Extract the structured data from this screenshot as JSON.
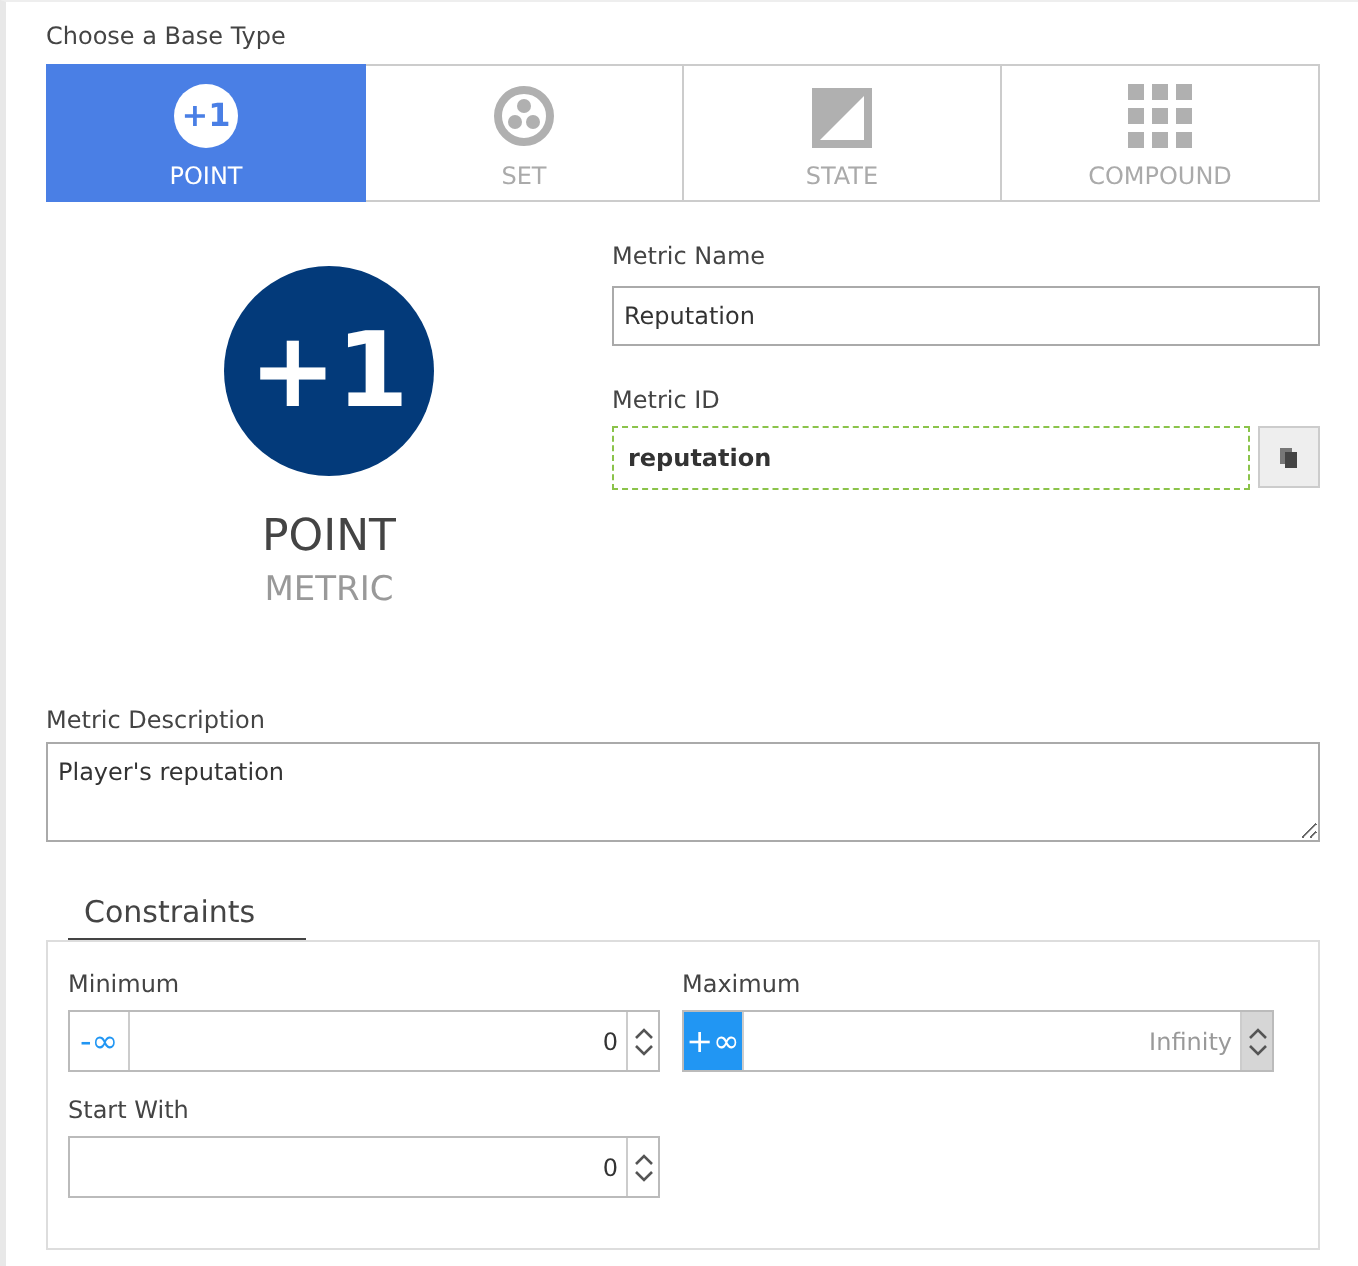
{
  "base_type": {
    "label": "Choose a Base Type",
    "tabs": [
      {
        "kind": "point",
        "label": "POINT",
        "icon_text": "+1",
        "selected": true
      },
      {
        "kind": "set",
        "label": "SET",
        "selected": false
      },
      {
        "kind": "state",
        "label": "STATE",
        "selected": false
      },
      {
        "kind": "compound",
        "label": "COMPOUND",
        "selected": false
      }
    ]
  },
  "preview": {
    "badge": "+1",
    "title": "POINT",
    "subtitle": "METRIC"
  },
  "metric_name": {
    "label": "Metric Name",
    "value": "Reputation"
  },
  "metric_id": {
    "label": "Metric ID",
    "value": "reputation"
  },
  "description": {
    "label": "Metric Description",
    "value": "Player's reputation"
  },
  "constraints": {
    "title": "Constraints",
    "fields": [
      {
        "label": "Minimum",
        "infinity": {
          "text": "-∞",
          "selected": false
        },
        "value": "0"
      },
      {
        "label": "Maximum",
        "infinity": {
          "text": "+∞",
          "selected": true
        },
        "placeholder": "Infinity"
      },
      {
        "label": "Start With",
        "value": "0"
      }
    ]
  }
}
